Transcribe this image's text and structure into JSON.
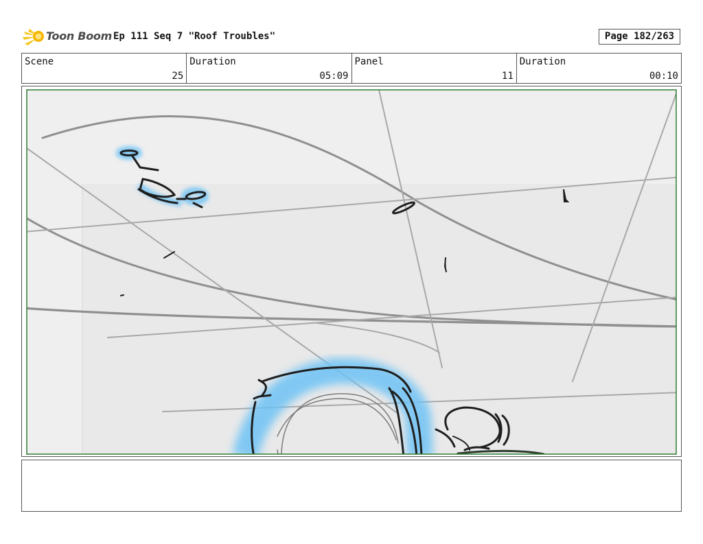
{
  "header": {
    "logo_text": "Toon Boom",
    "episode_title": "Ep 111 Seq 7 \"Roof Troubles\"",
    "page": "Page 182/263"
  },
  "info": {
    "scene_label": "Scene",
    "scene_value": "25",
    "duration_label": "Duration",
    "duration_value": "05:09",
    "panel_label": "Panel",
    "panel_value": "11",
    "panel_duration_label": "Duration",
    "panel_duration_value": "00:10"
  },
  "panel": {
    "safe_area_color": "#2e7d32",
    "highlight_color": "#6ec3f5",
    "sketch_color": "#222222"
  },
  "notes": {
    "text": ""
  }
}
